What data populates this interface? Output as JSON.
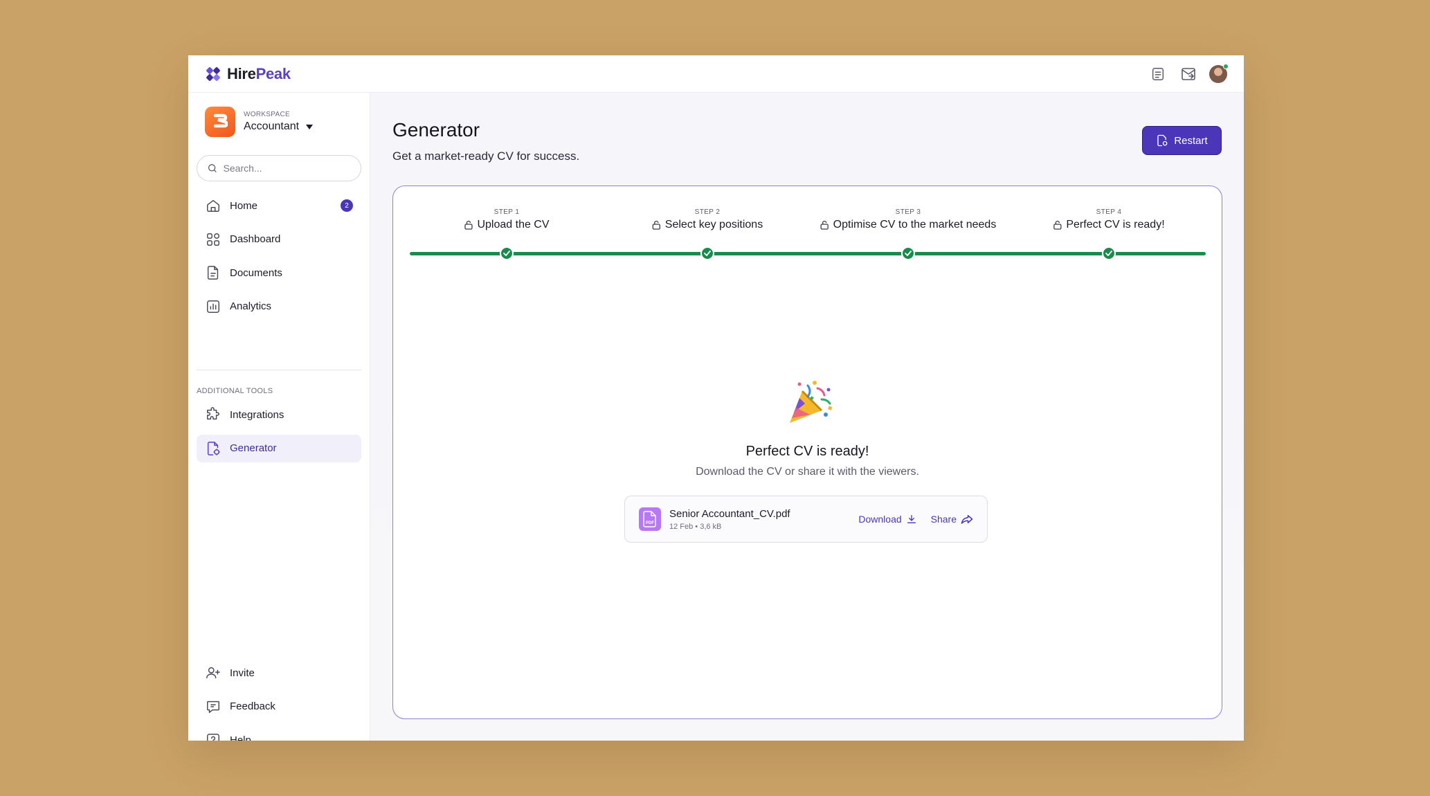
{
  "app": {
    "logo_part1": "Hire",
    "logo_part2": "Peak"
  },
  "topbar": {
    "icons": [
      "notes-icon",
      "inbox-icon",
      "user-avatar"
    ]
  },
  "workspace": {
    "label": "WORKSPACE",
    "name": "Accountant"
  },
  "search": {
    "placeholder": "Search..."
  },
  "nav": {
    "home": "Home",
    "home_badge": "2",
    "dashboard": "Dashboard",
    "documents": "Documents",
    "analytics": "Analytics",
    "section_label": "ADDITIONAL TOOLS",
    "integrations": "Integrations",
    "generator": "Generator",
    "invite": "Invite",
    "feedback": "Feedback",
    "help": "Help"
  },
  "page": {
    "title": "Generator",
    "subtitle": "Get a market-ready CV for success.",
    "restart_label": "Restart"
  },
  "steps": [
    {
      "num": "STEP 1",
      "title": "Upload the CV"
    },
    {
      "num": "STEP 2",
      "title": "Select key positions"
    },
    {
      "num": "STEP 3",
      "title": "Optimise CV to the market needs"
    },
    {
      "num": "STEP 4",
      "title": "Perfect CV is ready!"
    }
  ],
  "result": {
    "title": "Perfect CV is ready!",
    "subtitle": "Download the CV or share it with the viewers.",
    "file_name": "Senior Accountant_CV.pdf",
    "file_meta": "12 Feb • 3,6 kB",
    "pdf_tag": "PDF",
    "download_label": "Download",
    "share_label": "Share"
  },
  "colors": {
    "accent": "#4b35b8",
    "progress": "#1a8b4c",
    "workspace_logo": "#f2561d"
  }
}
